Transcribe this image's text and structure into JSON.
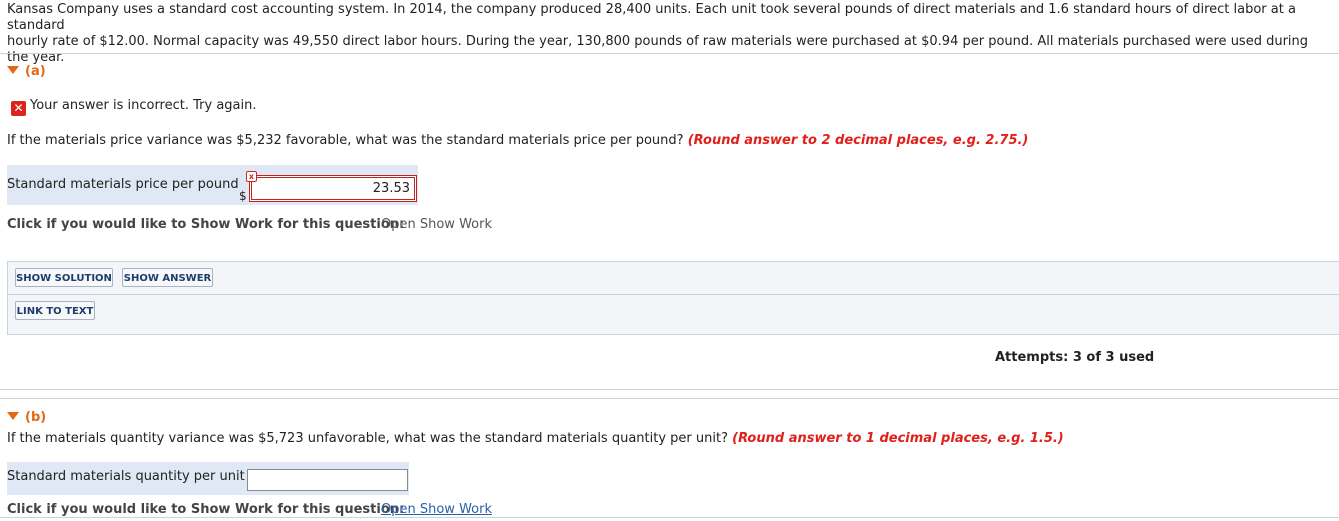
{
  "intro": {
    "line1": "Kansas Company uses a standard cost accounting system. In 2014, the company produced 28,400 units. Each unit took several pounds of direct materials and 1.6 standard hours of direct labor at a standard",
    "line2": "hourly rate of $12.00. Normal capacity was 49,550 direct labor hours. During the year, 130,800 pounds of raw materials were purchased at $0.94 per pound. All materials purchased were used during the year."
  },
  "part_a": {
    "header": "(a)",
    "feedback": "Your answer is incorrect.  Try again.",
    "question": "If the materials price variance was $5,232 favorable, what was the standard materials price per pound?",
    "note": "(Round answer to 2 decimal places, e.g. 2.75.)",
    "field_label": "Standard materials price per pound",
    "currency": "$",
    "field_value": "23.53",
    "show_work_label": "Click if you would like to Show Work for this question:",
    "show_work_link": "Open Show Work",
    "buttons": {
      "show_solution": "SHOW SOLUTION",
      "show_answer": "SHOW ANSWER",
      "link_to_text": "LINK TO TEXT"
    },
    "attempts": "Attempts: 3 of 3 used"
  },
  "part_b": {
    "header": "(b)",
    "question": "If the materials quantity variance was $5,723 unfavorable, what was the standard materials quantity per unit?",
    "note": "(Round answer to 1 decimal places, e.g. 1.5.)",
    "field_label": "Standard materials quantity per unit",
    "field_value": "",
    "show_work_label": "Click if you would like to Show Work for this question:",
    "show_work_link": "Open Show Work"
  },
  "colors": {
    "accent_orange": "#e06a14",
    "error_red": "#d9251c",
    "row_highlight": "#dfe8f4",
    "link_blue": "#2a5fa8"
  }
}
